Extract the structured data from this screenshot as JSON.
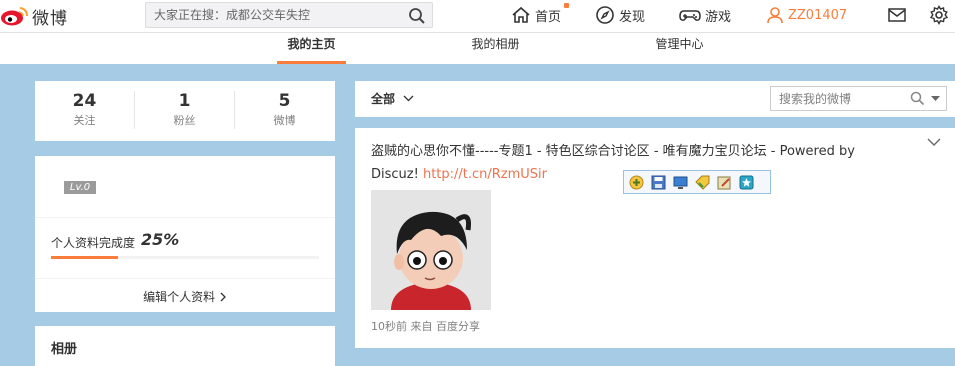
{
  "header": {
    "logo_text": "微博",
    "search": {
      "placeholder": "大家正在搜：成都公交车失控",
      "value": ""
    },
    "nav": [
      {
        "label": "首页",
        "icon": "home-icon"
      },
      {
        "label": "发现",
        "icon": "compass-icon"
      },
      {
        "label": "游戏",
        "icon": "gamepad-icon"
      },
      {
        "label": "ZZ01407",
        "icon": "user-icon"
      }
    ],
    "icons": [
      "mail-icon",
      "gear-icon"
    ]
  },
  "profile_tabs": [
    {
      "label": "我的主页",
      "active": true
    },
    {
      "label": "我的相册",
      "active": false
    },
    {
      "label": "管理中心",
      "active": false
    }
  ],
  "stats": [
    {
      "value": "24",
      "label": "关注"
    },
    {
      "value": "1",
      "label": "粉丝"
    },
    {
      "value": "5",
      "label": "微博"
    }
  ],
  "level": {
    "badge": "Lv.0",
    "completion_label": "个人资料完成度",
    "completion_value": "25%",
    "completion_fraction": 0.25,
    "edit_link": "编辑个人资料 "
  },
  "photos": {
    "title": "相册"
  },
  "feed_filter": {
    "label": "全部",
    "search_placeholder": "搜索我的微博"
  },
  "post": {
    "text": "盗贼的心思你不懂-----专题1 - 特色区综合讨论区 - 唯有魔力宝贝论坛 - Powered by Discuz! ",
    "link": "http://t.cn/RzmUSir",
    "meta": "10秒前 来自 百度分享"
  },
  "share_toolbar": [
    "add-icon",
    "save-icon",
    "screen-icon",
    "tag-icon",
    "edit-icon",
    "star-icon"
  ],
  "colors": {
    "accent": "#fa7d3c",
    "link": "#eb7350",
    "background": "#a6cbe4",
    "level_badge": "#9b9b9b"
  }
}
